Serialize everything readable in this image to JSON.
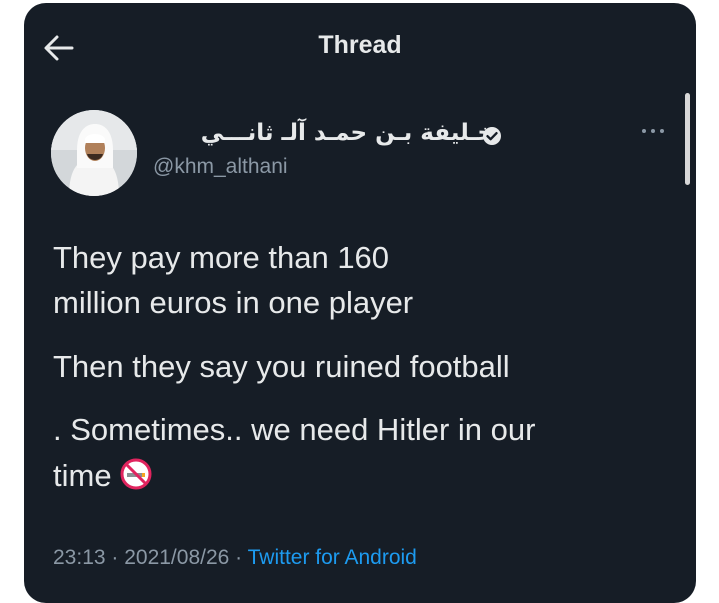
{
  "header": {
    "title": "Thread"
  },
  "tweet": {
    "display_name": "خـليفة بـن حمـد آلـ ثانـــي",
    "handle": "@khm_althani",
    "lines": [
      "They pay more than 160",
      "million euros in one player",
      "Then they say you ruined football",
      ". Sometimes.. we need Hitler in our",
      "time"
    ],
    "timestamp": "23:13 · 2021/08/26 · ",
    "source": "Twitter for Android"
  },
  "icons": {
    "back": "arrow-left-icon",
    "verified": "verified-badge-icon",
    "more": "more-dots-icon",
    "emoji": "no-smoking-emoji"
  },
  "colors": {
    "background": "#161d26",
    "text": "#e7e9ea",
    "secondary": "#8b98a5",
    "link": "#1d9bf0",
    "emoji_red": "#e0245e"
  }
}
